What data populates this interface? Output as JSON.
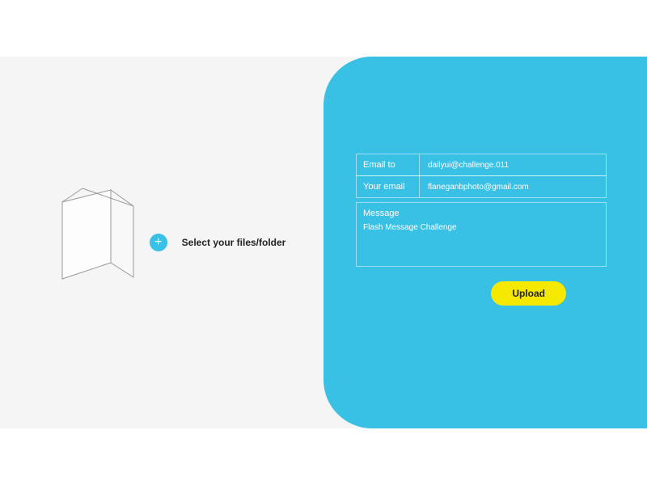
{
  "left": {
    "select_label": "Select your files/folder",
    "plus_glyph": "+"
  },
  "form": {
    "email_to": {
      "label": "Email to",
      "value": "dailyui@challenge.011"
    },
    "your_email": {
      "label": "Your email",
      "value": "flaneganbphoto@gmail.com"
    },
    "message": {
      "label": "Message",
      "value": "Flash Message Challenge"
    },
    "upload_label": "Upload"
  },
  "colors": {
    "accent": "#39c0e5",
    "button": "#f5e900"
  }
}
